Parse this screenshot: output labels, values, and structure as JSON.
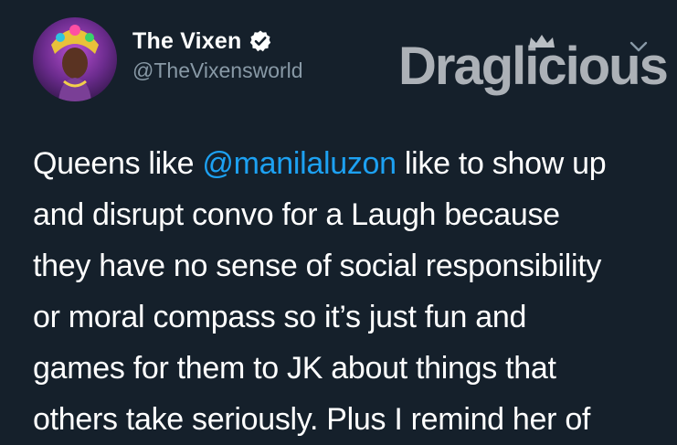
{
  "tweet": {
    "author": {
      "display_name": "The Vixen",
      "handle": "@TheVixensworld",
      "verified": true,
      "avatar_icon": "profile-photo"
    },
    "watermark": {
      "text": "Draglicious"
    },
    "text_lines": [
      {
        "before": "Queens like ",
        "mention": "@manilaluzon",
        "after": " like to show up"
      },
      {
        "text": "and disrupt convo for a Laugh because"
      },
      {
        "text": "they have no sense of social responsibility"
      },
      {
        "text": "or moral compass so it’s just fun and"
      },
      {
        "text": "games for them to JK about things that"
      },
      {
        "text": "others take seriously. Plus I remind her of"
      }
    ],
    "menu_icon": "chevron-down-icon"
  },
  "colors": {
    "background": "#15202b",
    "text": "#ffffff",
    "secondary_text": "#8899a6",
    "link": "#1da1f2",
    "verified_badge": "#ffffff"
  }
}
